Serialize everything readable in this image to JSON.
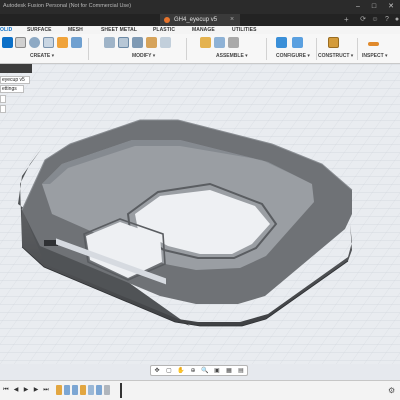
{
  "window": {
    "title": "Autodesk Fusion Personal (Not for Commercial Use)",
    "controls": [
      "–",
      "□",
      "✕"
    ]
  },
  "document_tab": {
    "name": "GH4_eyecup v5",
    "icon": "fusion-doc-icon",
    "close": "×"
  },
  "tabbar": {
    "plus": "+",
    "right_icons": [
      "refresh-icon",
      "user-icon",
      "help-icon",
      "notifications-icon"
    ]
  },
  "ribbon": {
    "tabs": [
      {
        "label": "OLID",
        "active": true
      },
      {
        "label": "SURFACE",
        "active": false
      },
      {
        "label": "MESH",
        "active": false
      },
      {
        "label": "SHEET METAL",
        "active": false
      },
      {
        "label": "PLASTIC",
        "active": false
      },
      {
        "label": "MANAGE",
        "active": false
      },
      {
        "label": "UTILITIES",
        "active": false
      }
    ],
    "groups": [
      {
        "label": "CREATE ▾"
      },
      {
        "label": "MODIFY ▾"
      },
      {
        "label": "ASSEMBLE ▾"
      },
      {
        "label": "CONFIGURE ▾"
      },
      {
        "label": "CONSTRUCT ▾"
      },
      {
        "label": "INSPECT ▾"
      }
    ],
    "accent_color": "#0b6fc7"
  },
  "browser": {
    "rows": [
      "eyecup v5",
      "ettings",
      ""
    ]
  },
  "nav_bar": {
    "buttons": [
      "✥",
      "▢",
      "✋",
      "⊕",
      "🔍",
      "▣",
      "▦",
      "▤"
    ]
  },
  "timeline": {
    "playback": [
      "⏮",
      "◀",
      "▶",
      "▶",
      "⏭"
    ],
    "settings_icon": "⚙"
  }
}
